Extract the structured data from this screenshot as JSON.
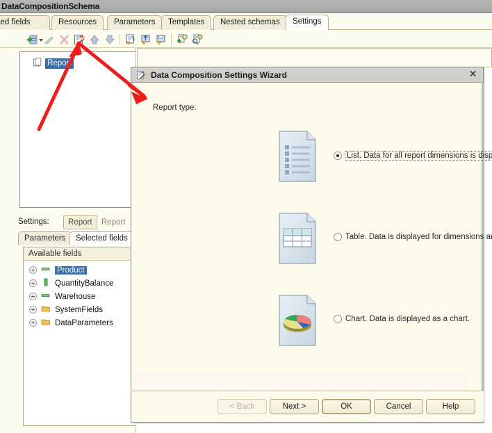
{
  "app": {
    "title": "DataCompositionSchema",
    "tabs": [
      {
        "label": "ulated fields",
        "active": false
      },
      {
        "label": "Resources",
        "active": false
      },
      {
        "label": "Parameters",
        "active": false
      },
      {
        "label": "Templates",
        "active": false
      },
      {
        "label": "Nested schemas",
        "active": false
      },
      {
        "label": "Settings",
        "active": true
      }
    ],
    "toolbar": {
      "items": [
        {
          "name": "add-icon",
          "title": "Add"
        },
        {
          "name": "dropdown-arrow-icon",
          "title": "Add variants"
        },
        {
          "name": "edit-pencil-icon",
          "title": "Edit"
        },
        {
          "name": "delete-x-icon",
          "title": "Delete"
        },
        {
          "name": "settings-wizard-icon",
          "title": "Settings wizard"
        },
        {
          "name": "move-up-icon",
          "title": "Move up"
        },
        {
          "name": "move-down-icon",
          "title": "Move down"
        },
        {
          "name": "restore-settings-icon",
          "title": "Restore settings"
        },
        {
          "name": "load-settings-icon",
          "title": "Load settings"
        },
        {
          "name": "save-settings-icon",
          "title": "Save settings"
        },
        {
          "name": "add-custom-settings-icon",
          "title": "Add custom settings"
        },
        {
          "name": "find-custom-settings-icon",
          "title": "Find custom settings"
        }
      ]
    },
    "tree": {
      "root_label": "Report",
      "root_icon": "report-page-icon"
    },
    "settings_bar": {
      "label": "Settings:",
      "buttons": [
        {
          "label": "Report",
          "selected": true
        },
        {
          "label": "Report",
          "selected": false
        }
      ]
    },
    "subtabs": [
      {
        "label": "Parameters",
        "active": false
      },
      {
        "label": "Selected fields",
        "active": true
      }
    ],
    "fields_panel": {
      "header": "Available fields",
      "items": [
        {
          "label": "Product",
          "icon": "dimension-icon",
          "selected": true
        },
        {
          "label": "QuantityBalance",
          "icon": "resource-icon",
          "selected": false
        },
        {
          "label": "Warehouse",
          "icon": "dimension-icon",
          "selected": false
        },
        {
          "label": "SystemFields",
          "icon": "folder-icon",
          "selected": false
        },
        {
          "label": "DataParameters",
          "icon": "folder-icon",
          "selected": false
        }
      ]
    }
  },
  "dialog": {
    "title": "Data Composition Settings Wizard",
    "title_icon": "settings-wizard-icon",
    "close_label": "✕",
    "section_label": "Report type:",
    "options": [
      {
        "id": "list",
        "label": "List. Data for all report dimensions is displayed as a list.",
        "checked": true,
        "focused": true,
        "icon": "list-preview-icon"
      },
      {
        "id": "table",
        "label": "Table. Data is displayed for dimensions arranged both horizontally and vertically.",
        "checked": false,
        "focused": false,
        "icon": "table-preview-icon"
      },
      {
        "id": "chart",
        "label": "Chart. Data is displayed as a chart.",
        "checked": false,
        "focused": false,
        "icon": "chart-preview-icon"
      }
    ],
    "buttons": [
      {
        "id": "back",
        "label": "< Back",
        "disabled": true,
        "default": false
      },
      {
        "id": "next",
        "label": "Next >",
        "disabled": false,
        "default": false
      },
      {
        "id": "ok",
        "label": "OK",
        "disabled": false,
        "default": true
      },
      {
        "id": "cancel",
        "label": "Cancel",
        "disabled": false,
        "default": false
      },
      {
        "id": "help",
        "label": "Help",
        "disabled": false,
        "default": false
      }
    ]
  },
  "annotations": {
    "arrow_color": "#ee1c1c",
    "arrows": [
      {
        "name": "arrow-to-wizard-toolbar-button"
      },
      {
        "name": "arrow-to-wizard-dialog"
      }
    ]
  },
  "colors": {
    "accent_selection": "#3a6ea5",
    "dialog_bg": "#fcfaea",
    "panel_bg": "#fcfbf0",
    "titlebar_bg": "#aeaeac",
    "annotation_red": "#ee1c1c"
  }
}
